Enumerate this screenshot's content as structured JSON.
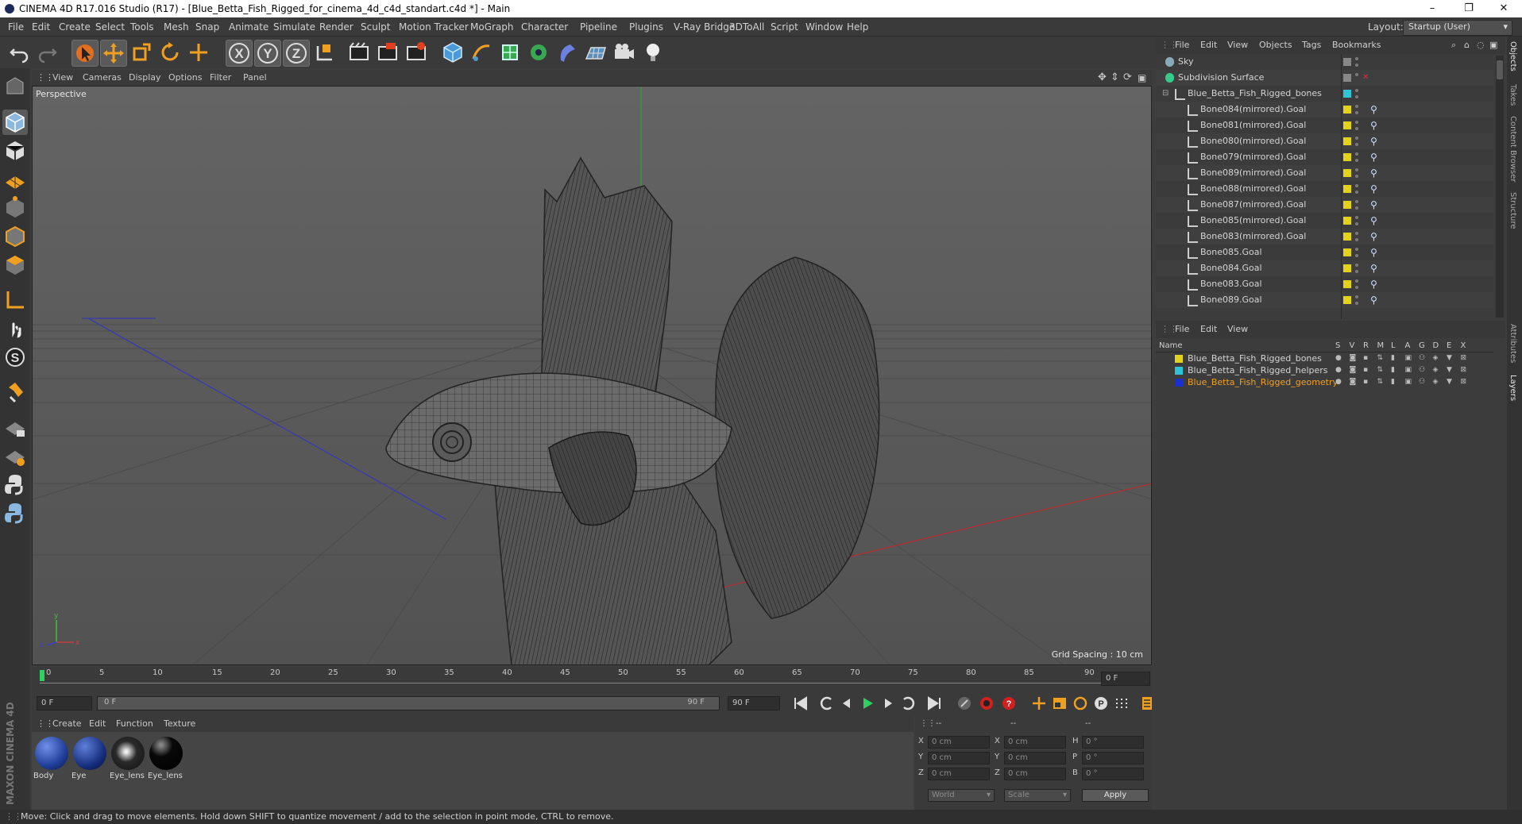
{
  "window": {
    "title": "CINEMA 4D R17.016 Studio (R17) - [Blue_Betta_Fish_Rigged_for_cinema_4d_c4d_standart.c4d *] - Main",
    "minimize": "–",
    "maximize": "❐",
    "close": "✕"
  },
  "menu": [
    "File",
    "Edit",
    "Create",
    "Select",
    "Tools",
    "Mesh",
    "Snap",
    "Animate",
    "Simulate",
    "Render",
    "Sculpt",
    "Motion Tracker",
    "MoGraph",
    "Character",
    "Pipeline",
    "Plugins",
    "V-Ray Bridge",
    "3DToAll",
    "Script",
    "Window",
    "Help"
  ],
  "layout": {
    "label": "Layout:",
    "value": "Startup (User)"
  },
  "toolbar_icons": [
    "undo-icon",
    "redo-icon",
    "live-selection-icon",
    "move-icon",
    "scale-icon",
    "rotate-icon",
    "recent-tools-icon",
    "x-axis-icon",
    "y-axis-icon",
    "z-axis-icon",
    "coordinate-system-icon",
    "render-view-icon",
    "render-picture-viewer-icon",
    "edit-render-settings-icon",
    "cube-icon",
    "pen-icon",
    "subdivision-icon",
    "array-icon",
    "deformer-icon",
    "floor-icon",
    "camera-icon",
    "light-icon"
  ],
  "viewport": {
    "menu": [
      "View",
      "Cameras",
      "Display",
      "Options",
      "Filter",
      "Panel"
    ],
    "label": "Perspective",
    "grid_spacing": "Grid Spacing : 10 cm"
  },
  "timeline": {
    "ticks": [
      "0",
      "5",
      "10",
      "15",
      "20",
      "25",
      "30",
      "35",
      "40",
      "45",
      "50",
      "55",
      "60",
      "65",
      "70",
      "75",
      "80",
      "85",
      "90"
    ],
    "current_frame": "0 F",
    "start": "0 F",
    "range_start": "0 F",
    "range_end": "90 F",
    "end": "90 F"
  },
  "materials": {
    "menu": [
      "Create",
      "Edit",
      "Function",
      "Texture"
    ],
    "items": [
      {
        "label": "Body",
        "color": "#1f3f9a"
      },
      {
        "label": "Eye",
        "color": "#173080"
      },
      {
        "label": "Eye_lens",
        "color": "#2a2a2a"
      },
      {
        "label": "Eye_lens",
        "color": "#080808"
      }
    ]
  },
  "coordinates": {
    "header": [
      "--",
      "--",
      "--"
    ],
    "rows": [
      {
        "a": "X",
        "av": "0 cm",
        "b": "X",
        "bv": "0 cm",
        "c": "H",
        "cv": "0 °"
      },
      {
        "a": "Y",
        "av": "0 cm",
        "b": "Y",
        "bv": "0 cm",
        "c": "P",
        "cv": "0 °"
      },
      {
        "a": "Z",
        "av": "0 cm",
        "b": "Z",
        "bv": "0 cm",
        "c": "B",
        "cv": "0 °"
      }
    ],
    "space": "World",
    "mode": "Scale",
    "apply": "Apply"
  },
  "objects": {
    "menu": [
      "File",
      "Edit",
      "View",
      "Objects",
      "Tags",
      "Bookmarks"
    ],
    "rows": [
      {
        "name": "Sky",
        "indent": 0,
        "color": "#888888"
      },
      {
        "name": "Subdivision Surface",
        "indent": 0,
        "color": "#888888"
      },
      {
        "name": "Blue_Betta_Fish_Rigged_bones",
        "indent": 1,
        "color": "#2fc3d6"
      },
      {
        "name": "Bone084(mirrored).Goal",
        "indent": 2,
        "color": "#e2d21c"
      },
      {
        "name": "Bone081(mirrored).Goal",
        "indent": 2,
        "color": "#e2d21c"
      },
      {
        "name": "Bone080(mirrored).Goal",
        "indent": 2,
        "color": "#e2d21c"
      },
      {
        "name": "Bone079(mirrored).Goal",
        "indent": 2,
        "color": "#e2d21c"
      },
      {
        "name": "Bone089(mirrored).Goal",
        "indent": 2,
        "color": "#e2d21c"
      },
      {
        "name": "Bone088(mirrored).Goal",
        "indent": 2,
        "color": "#e2d21c"
      },
      {
        "name": "Bone087(mirrored).Goal",
        "indent": 2,
        "color": "#e2d21c"
      },
      {
        "name": "Bone085(mirrored).Goal",
        "indent": 2,
        "color": "#e2d21c"
      },
      {
        "name": "Bone083(mirrored).Goal",
        "indent": 2,
        "color": "#e2d21c"
      },
      {
        "name": "Bone085.Goal",
        "indent": 2,
        "color": "#e2d21c"
      },
      {
        "name": "Bone084.Goal",
        "indent": 2,
        "color": "#e2d21c"
      },
      {
        "name": "Bone083.Goal",
        "indent": 2,
        "color": "#e2d21c"
      },
      {
        "name": "Bone089.Goal",
        "indent": 2,
        "color": "#e2d21c"
      }
    ]
  },
  "layers": {
    "menu": [
      "File",
      "Edit",
      "View"
    ],
    "header": {
      "name": "Name",
      "cols": [
        "S",
        "V",
        "R",
        "M",
        "L",
        "A",
        "G",
        "D",
        "E",
        "X"
      ]
    },
    "rows": [
      {
        "name": "Blue_Betta_Fish_Rigged_bones",
        "color": "#e2d21c",
        "text_color": "#d4d4d4"
      },
      {
        "name": "Blue_Betta_Fish_Rigged_helpers",
        "color": "#2fc3d6",
        "text_color": "#d4d4d4"
      },
      {
        "name": "Blue_Betta_Fish_Rigged_geometry",
        "color": "#1a2fd0",
        "text_color": "#f0a020"
      }
    ]
  },
  "right_tabs": [
    "Objects",
    "Takes",
    "Content Browser",
    "Structure",
    "Attributes",
    "Layers"
  ],
  "brand": "MAXON CINEMA 4D",
  "status": "Move: Click and drag to move elements. Hold down SHIFT to quantize movement / add to the selection in point mode, CTRL to remove."
}
